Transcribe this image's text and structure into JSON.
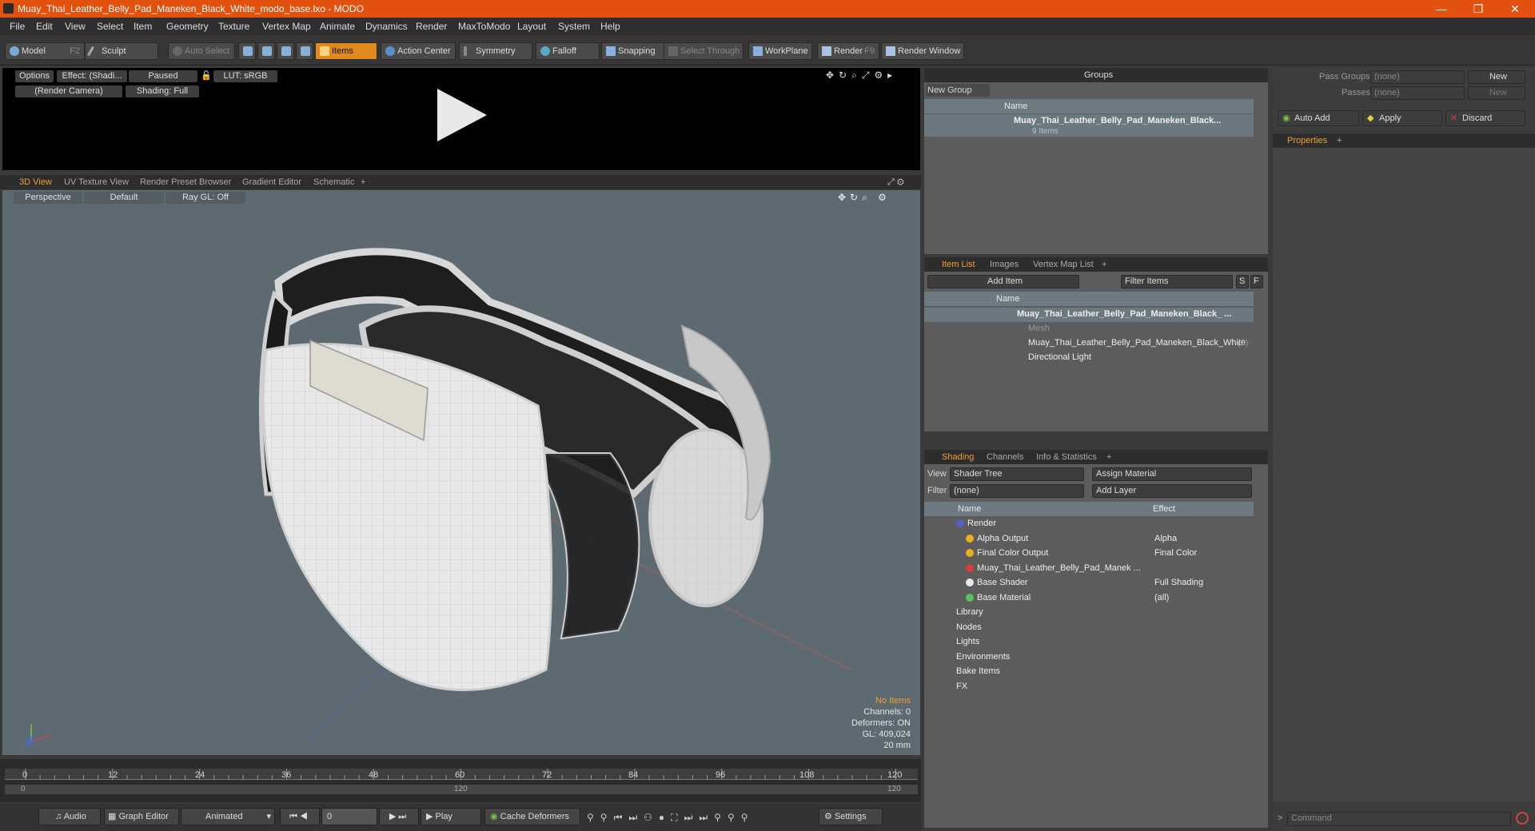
{
  "window": {
    "title": "Muay_Thai_Leather_Belly_Pad_Maneken_Black_White_modo_base.lxo - MODO",
    "minimize": "—",
    "maximize": "❐",
    "close": "✕"
  },
  "menu": [
    "File",
    "Edit",
    "View",
    "Select",
    "Item",
    "Geometry",
    "Texture",
    "Vertex Map",
    "Animate",
    "Dynamics",
    "Render",
    "MaxToModo",
    "Layout",
    "System",
    "Help"
  ],
  "toolbar": {
    "model": "Model",
    "model_key": "F2",
    "sculpt": "Sculpt",
    "auto_select": "Auto Select",
    "items": "Items",
    "action_center": "Action Center",
    "symmetry": "Symmetry",
    "falloff": "Falloff",
    "snapping": "Snapping",
    "select_through": "Select Through",
    "workplane": "WorkPlane",
    "render": "Render",
    "render_key": "F9",
    "render_window": "Render Window"
  },
  "preview": {
    "options": "Options",
    "effect": "Effect: (Shadi...",
    "paused": "Paused",
    "lut": "LUT: sRGB",
    "camera": "(Render Camera)",
    "shading": "Shading: Full"
  },
  "view_tabs": [
    "3D View",
    "UV Texture View",
    "Render Preset Browser",
    "Gradient Editor",
    "Schematic",
    "+"
  ],
  "viewport": {
    "projection": "Perspective",
    "style": "Default",
    "raygl": "Ray GL: Off",
    "info": {
      "items": "No Items",
      "channels": "Channels: 0",
      "deformers": "Deformers: ON",
      "gl": "GL: 409,024",
      "scale": "20 mm"
    }
  },
  "timeline": {
    "ticks": [
      "0",
      "12",
      "24",
      "36",
      "48",
      "60",
      "72",
      "84",
      "96",
      "108",
      "120"
    ],
    "start": "0",
    "mid": "120",
    "end": "120"
  },
  "transport": {
    "audio": "Audio",
    "graph_editor": "Graph Editor",
    "animated": "Animated",
    "frame": "0",
    "play": "Play",
    "cache_deformers": "Cache Deformers",
    "settings": "Settings"
  },
  "groups": {
    "title": "Groups",
    "new_group": "New Group",
    "col_name": "Name",
    "item_name": "Muay_Thai_Leather_Belly_Pad_Maneken_Black...",
    "item_count": "9 Items"
  },
  "itemlist": {
    "tabs": [
      "Item List",
      "Images",
      "Vertex Map List",
      "+"
    ],
    "add_item": "Add Item",
    "filter": "Filter Items",
    "s": "S",
    "f": "F",
    "col_name": "Name",
    "rows": [
      "Muay_Thai_Leather_Belly_Pad_Maneken_Black_ ...",
      "Mesh",
      "Muay_Thai_Leather_Belly_Pad_Maneken_Black_White",
      "Directional Light"
    ],
    "row2_count": "(2)"
  },
  "shading": {
    "tabs": [
      "Shading",
      "Channels",
      "Info & Statistics",
      "+"
    ],
    "view_label": "View",
    "view_value": "Shader Tree",
    "assign": "Assign Material",
    "filter_label": "Filter",
    "filter_value": "(none)",
    "add_layer": "Add Layer",
    "col_name": "Name",
    "col_effect": "Effect",
    "rows": [
      {
        "name": "Render",
        "effect": ""
      },
      {
        "name": "Alpha Output",
        "effect": "Alpha"
      },
      {
        "name": "Final Color Output",
        "effect": "Final Color"
      },
      {
        "name": "Muay_Thai_Leather_Belly_Pad_Manek ...",
        "effect": ""
      },
      {
        "name": "Base Shader",
        "effect": "Full Shading"
      },
      {
        "name": "Base Material",
        "effect": "(all)"
      },
      {
        "name": "Library",
        "effect": ""
      },
      {
        "name": "Nodes",
        "effect": ""
      },
      {
        "name": "Lights",
        "effect": ""
      },
      {
        "name": "Environments",
        "effect": ""
      },
      {
        "name": "Bake Items",
        "effect": ""
      },
      {
        "name": "FX",
        "effect": ""
      }
    ]
  },
  "properties": {
    "pass_groups": "Pass Groups",
    "passes": "Passes",
    "none": "(none)",
    "new": "New",
    "auto_add": "Auto Add",
    "apply": "Apply",
    "discard": "Discard",
    "tab": "Properties",
    "command": "Command"
  }
}
